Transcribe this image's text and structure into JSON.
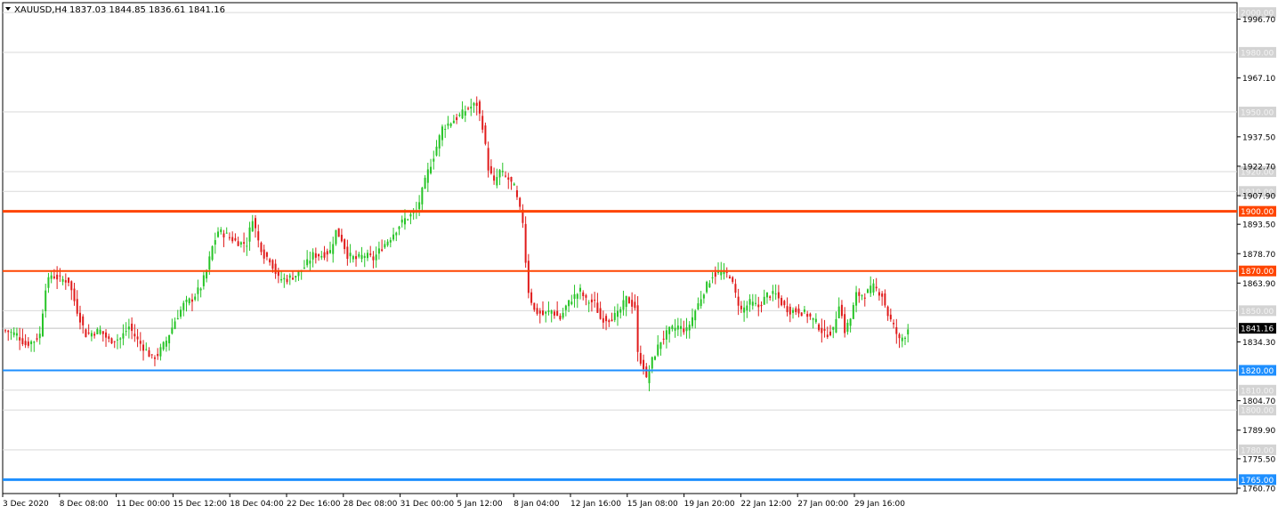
{
  "header": {
    "symbol": "XAUUSD,H4",
    "ohlc": "1837.03 1844.85 1836.61 1841.16"
  },
  "chart_data": {
    "type": "candlestick",
    "title": "XAUUSD,H4",
    "ylim": [
      1758,
      2005
    ],
    "y_ticks": [
      1996.7,
      1967.1,
      1937.5,
      1922.7,
      1907.9,
      1893.5,
      1878.7,
      1863.9,
      1834.3,
      1804.7,
      1789.9,
      1775.5,
      1760.7
    ],
    "x_ticks": [
      "3 Dec 2020",
      "8 Dec 08:00",
      "11 Dec 00:00",
      "15 Dec 12:00",
      "18 Dec 04:00",
      "22 Dec 16:00",
      "28 Dec 08:00",
      "31 Dec 00:00",
      "5 Jan 12:00",
      "8 Jan 04:00",
      "12 Jan 16:00",
      "15 Jan 08:00",
      "19 Jan 20:00",
      "22 Jan 12:00",
      "27 Jan 00:00",
      "29 Jan 16:00"
    ],
    "current_price": 1841.16,
    "up_color": "#26c426",
    "down_color": "#e01b1b",
    "levels": [
      {
        "price": 1900.0,
        "label": "1900.00",
        "color": "#ff4500",
        "style": "thick"
      },
      {
        "price": 1870.0,
        "label": "1870.00",
        "color": "#ff4500",
        "style": "normal"
      },
      {
        "price": 1820.0,
        "label": "1820.00",
        "color": "#1e8fff",
        "style": "normal"
      },
      {
        "price": 1765.0,
        "label": "1765.00",
        "color": "#1e8fff",
        "style": "thick"
      }
    ],
    "minor_levels": [
      {
        "price": 2000.0,
        "label": "2000.00"
      },
      {
        "price": 1980.0,
        "label": "1980.00"
      },
      {
        "price": 1950.0,
        "label": "1950.00"
      },
      {
        "price": 1920.0,
        "label": "1920.00"
      },
      {
        "price": 1910.0,
        "label": "1910.00"
      },
      {
        "price": 1850.0,
        "label": "1850.00"
      },
      {
        "price": 1810.0,
        "label": "1810.00"
      },
      {
        "price": 1800.0,
        "label": "1800.00"
      },
      {
        "price": 1780.0,
        "label": "1780.00"
      }
    ],
    "anchors": [
      [
        0,
        1840
      ],
      [
        4,
        1838
      ],
      [
        7,
        1833
      ],
      [
        10,
        1835
      ],
      [
        12,
        1838
      ],
      [
        14,
        1862
      ],
      [
        16,
        1868
      ],
      [
        19,
        1866
      ],
      [
        22,
        1865
      ],
      [
        25,
        1850
      ],
      [
        28,
        1838
      ],
      [
        33,
        1840
      ],
      [
        36,
        1835
      ],
      [
        40,
        1836
      ],
      [
        43,
        1842
      ],
      [
        46,
        1835
      ],
      [
        49,
        1830
      ],
      [
        51,
        1826
      ],
      [
        53,
        1828
      ],
      [
        56,
        1835
      ],
      [
        59,
        1845
      ],
      [
        62,
        1853
      ],
      [
        65,
        1856
      ],
      [
        68,
        1862
      ],
      [
        70,
        1870
      ],
      [
        72,
        1882
      ],
      [
        74,
        1890
      ],
      [
        77,
        1888
      ],
      [
        80,
        1885
      ],
      [
        82,
        1884
      ],
      [
        84,
        1884
      ],
      [
        86,
        1897
      ],
      [
        88,
        1885
      ],
      [
        90,
        1878
      ],
      [
        92,
        1876
      ],
      [
        95,
        1866
      ],
      [
        98,
        1866
      ],
      [
        101,
        1868
      ],
      [
        104,
        1872
      ],
      [
        107,
        1878
      ],
      [
        110,
        1878
      ],
      [
        113,
        1880
      ],
      [
        115,
        1890
      ],
      [
        117,
        1886
      ],
      [
        119,
        1878
      ],
      [
        122,
        1876
      ],
      [
        125,
        1878
      ],
      [
        128,
        1876
      ],
      [
        131,
        1882
      ],
      [
        134,
        1887
      ],
      [
        137,
        1893
      ],
      [
        139,
        1896
      ],
      [
        141,
        1898
      ],
      [
        143,
        1900
      ],
      [
        145,
        1910
      ],
      [
        147,
        1920
      ],
      [
        149,
        1928
      ],
      [
        152,
        1942
      ],
      [
        155,
        1945
      ],
      [
        158,
        1948
      ],
      [
        161,
        1952
      ],
      [
        164,
        1954
      ],
      [
        166,
        1943
      ],
      [
        168,
        1922
      ],
      [
        170,
        1914
      ],
      [
        172,
        1920
      ],
      [
        175,
        1916
      ],
      [
        177,
        1912
      ],
      [
        178,
        1906
      ],
      [
        180,
        1895
      ],
      [
        181,
        1875
      ],
      [
        182,
        1860
      ],
      [
        184,
        1850
      ],
      [
        187,
        1848
      ],
      [
        190,
        1850
      ],
      [
        193,
        1846
      ],
      [
        195,
        1852
      ],
      [
        197,
        1856
      ],
      [
        200,
        1860
      ],
      [
        202,
        1855
      ],
      [
        205,
        1854
      ],
      [
        207,
        1846
      ],
      [
        210,
        1846
      ],
      [
        213,
        1848
      ],
      [
        216,
        1856
      ],
      [
        219,
        1852
      ],
      [
        220,
        1828
      ],
      [
        222,
        1822
      ],
      [
        223,
        1815
      ],
      [
        225,
        1825
      ],
      [
        228,
        1835
      ],
      [
        231,
        1840
      ],
      [
        234,
        1842
      ],
      [
        237,
        1840
      ],
      [
        240,
        1850
      ],
      [
        243,
        1860
      ],
      [
        246,
        1868
      ],
      [
        249,
        1869
      ],
      [
        252,
        1868
      ],
      [
        254,
        1858
      ],
      [
        256,
        1850
      ],
      [
        259,
        1854
      ],
      [
        262,
        1852
      ],
      [
        265,
        1858
      ],
      [
        268,
        1858
      ],
      [
        271,
        1852
      ],
      [
        273,
        1850
      ],
      [
        276,
        1850
      ],
      [
        279,
        1848
      ],
      [
        282,
        1844
      ],
      [
        285,
        1838
      ],
      [
        288,
        1840
      ],
      [
        290,
        1854
      ],
      [
        292,
        1840
      ],
      [
        294,
        1846
      ],
      [
        296,
        1858
      ],
      [
        299,
        1858
      ],
      [
        302,
        1862
      ],
      [
        305,
        1858
      ],
      [
        307,
        1848
      ],
      [
        309,
        1842
      ],
      [
        311,
        1835
      ],
      [
        313,
        1838
      ],
      [
        314,
        1842
      ]
    ]
  }
}
